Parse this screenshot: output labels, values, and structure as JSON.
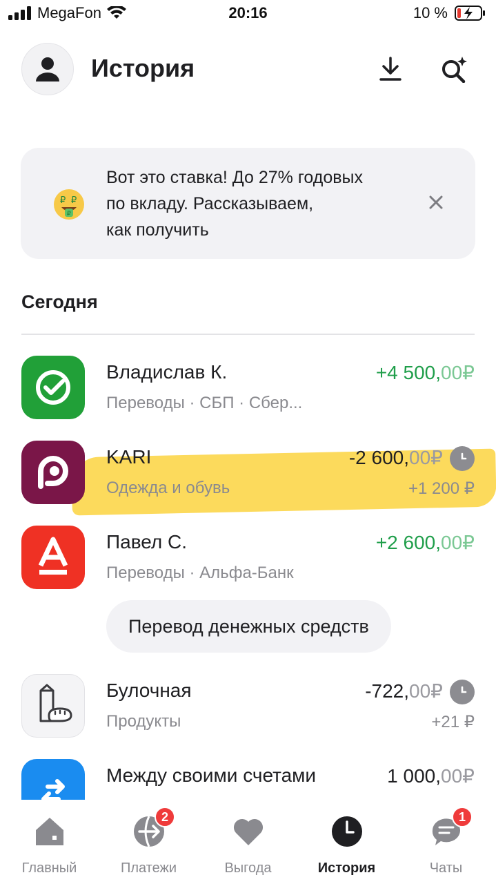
{
  "status_bar": {
    "carrier": "MegaFon",
    "time": "20:16",
    "battery": "10 %"
  },
  "header": {
    "title": "История",
    "avatar_icon": "user-icon",
    "download_icon": "download-icon",
    "search_icon": "sparkle-search-icon"
  },
  "promo": {
    "line1": "Вот это ставка! До 27% годовых",
    "line2": "по вкладу. Рассказываем,",
    "line3": "как получить",
    "emoji_icon": "money-mouth-face-icon",
    "close_icon": "close-icon"
  },
  "section": {
    "title": "Сегодня"
  },
  "transactions": [
    {
      "name": "Владислав К.",
      "subtitle": "Переводы · СБП · Сбер...",
      "amount_main": "+4 500,",
      "amount_cents": "00",
      "currency": "₽",
      "icon": "sber-icon",
      "icon_color": "#21a038"
    },
    {
      "name": "KARI",
      "subtitle": "Одежда и обувь",
      "amount_main": "-2 600,",
      "amount_cents": "00",
      "currency": "₽",
      "bonus": "+1 200 ₽",
      "icon": "kari-icon",
      "icon_color": "#7a1648"
    },
    {
      "name": "Павел С.",
      "subtitle": "Переводы · Альфа-Банк",
      "amount_main": "+2 600,",
      "amount_cents": "00",
      "currency": "₽",
      "comment": "Перевод денежных средств",
      "icon": "alfa-bank-icon",
      "icon_color": "#ef3124"
    },
    {
      "name": "Булочная",
      "subtitle": "Продукты",
      "amount_main": "-722,",
      "amount_cents": "00",
      "currency": "₽",
      "bonus": "+21 ₽",
      "icon": "bakery-icon",
      "icon_color": "#f4f4f6"
    },
    {
      "name": "Между своими счетами",
      "subtitle": "",
      "amount_main": "1 000,",
      "amount_cents": "00",
      "currency": "₽",
      "icon": "transfer-arrows-icon",
      "icon_color": "#1a8cf0"
    }
  ],
  "tabs": [
    {
      "label": "Главный",
      "icon": "home-icon"
    },
    {
      "label": "Платежи",
      "icon": "payments-icon",
      "badge": "2"
    },
    {
      "label": "Выгода",
      "icon": "heart-icon"
    },
    {
      "label": "История",
      "icon": "clock-icon",
      "active": true
    },
    {
      "label": "Чаты",
      "icon": "chat-icon",
      "badge": "1"
    }
  ],
  "colors": {
    "positive": "#1f9e4a",
    "highlight": "#fcd33f",
    "badge": "#ef3b3b"
  }
}
